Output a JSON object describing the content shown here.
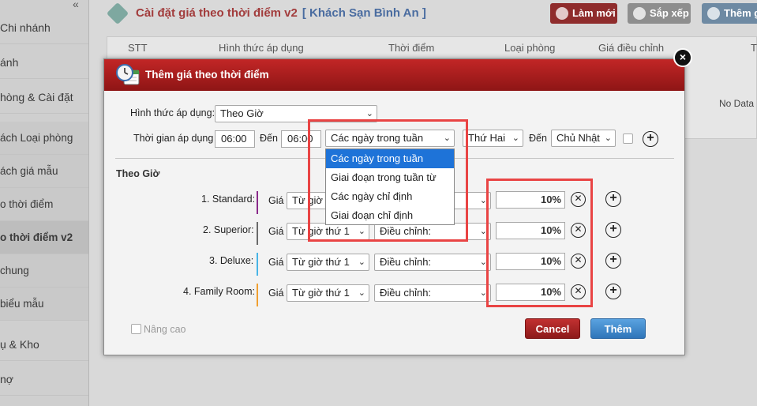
{
  "sidebar": {
    "collapse_glyph": "«",
    "items": [
      {
        "label": "Chi nhánh"
      },
      {
        "label": "ánh"
      },
      {
        "label": "hòng & Cài đặt"
      },
      {
        "label": "ách Loại phòng"
      },
      {
        "label": "ách giá mẫu"
      },
      {
        "label": "o thời điểm"
      },
      {
        "label": "o thời điểm v2"
      },
      {
        "label": " chung"
      },
      {
        "label": " biểu mẫu"
      },
      {
        "label": "ụ & Kho"
      },
      {
        "label": "nợ"
      }
    ]
  },
  "header": {
    "title": "Cài đặt giá theo thời điểm v2",
    "hotel": "[ Khách Sạn Bình An ]",
    "btn_new": "Làm mới",
    "btn_sort": "Sắp xếp",
    "btn_add": "Thêm g"
  },
  "table": {
    "columns": [
      "STT",
      "Hình thức áp dụng",
      "Thời điểm",
      "Loại phòng",
      "Giá điều chỉnh",
      "T"
    ],
    "empty_text": "No Data"
  },
  "modal": {
    "title": "Thêm giá theo thời điểm",
    "close_glyph": "×",
    "apply_type_label": "Hình thức áp dụng:",
    "apply_type_value": "Theo Giờ",
    "time_label": "Thời gian áp dụng",
    "time_from": "06:00",
    "to_label": "Đến",
    "time_to": "06:00",
    "period_value": "Các ngày trong tuần",
    "day_from": "Thứ Hai",
    "to_label2": "Đến",
    "day_to": "Chủ Nhật",
    "dropdown_options": [
      "Các ngày trong tuần",
      "Giai đoạn trong tuần từ",
      "Các ngày chỉ định",
      "Giai đoạn chỉ định"
    ],
    "section_title": "Theo Giờ",
    "rows": [
      {
        "name": "1. Standard:",
        "price_label": "Giá",
        "from": "Từ giờ",
        "adjust": "",
        "percent": "10%",
        "bar_color": "#8a2a8a"
      },
      {
        "name": "2. Superior:",
        "price_label": "Giá",
        "from": "Từ giờ thứ 1",
        "adjust": "Điều chỉnh:",
        "percent": "10%",
        "bar_color": "#6a6a6a"
      },
      {
        "name": "3. Deluxe:",
        "price_label": "Giá",
        "from": "Từ giờ thứ 1",
        "adjust": "Điều chỉnh:",
        "percent": "10%",
        "bar_color": "#48b4e6"
      },
      {
        "name": "4. Family Room:",
        "price_label": "Giá",
        "from": "Từ giờ thứ 1",
        "adjust": "Điều chỉnh:",
        "percent": "10%",
        "bar_color": "#f0a030"
      }
    ],
    "advanced_label": "Nâng cao",
    "cancel_label": "Cancel",
    "add_label": "Thêm"
  },
  "colors": {
    "accent_red": "#b21f1f",
    "highlight": "#e94444",
    "selected_option": "#1e73d8"
  }
}
